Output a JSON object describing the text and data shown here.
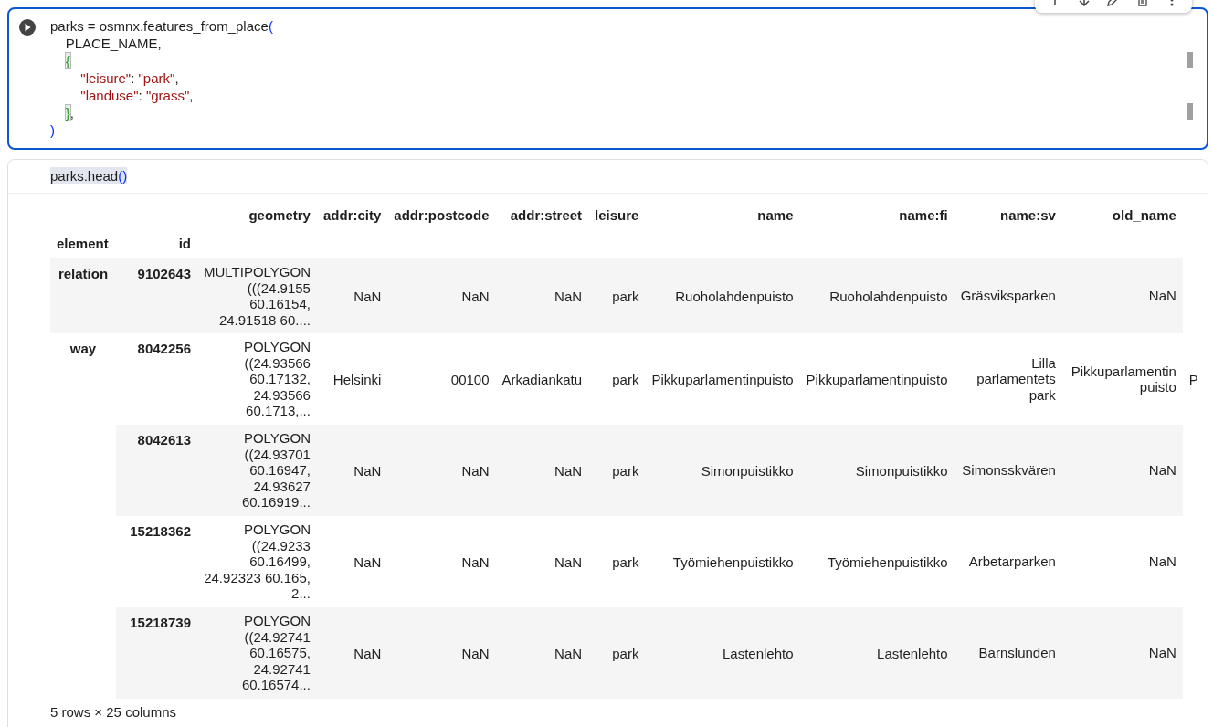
{
  "code_cell": {
    "selected": true,
    "lines": [
      [
        {
          "t": "parks = osmnx.features_from_place",
          "kind": "plain"
        },
        {
          "t": "(",
          "kind": "paren"
        }
      ],
      [
        {
          "t": "    PLACE_NAME,",
          "kind": "plain"
        }
      ],
      [
        {
          "t": "    {",
          "kind": "match"
        }
      ],
      [
        {
          "t": "        \"leisure\"",
          "kind": "string"
        },
        {
          "t": ": ",
          "kind": "plain"
        },
        {
          "t": "\"park\"",
          "kind": "string"
        },
        {
          "t": ",",
          "kind": "plain"
        }
      ],
      [
        {
          "t": "        \"landuse\"",
          "kind": "string"
        },
        {
          "t": ": ",
          "kind": "plain"
        },
        {
          "t": "\"grass\"",
          "kind": "string"
        },
        {
          "t": ",",
          "kind": "plain"
        }
      ],
      [
        {
          "t": "    }",
          "kind": "match"
        },
        {
          "t": ",",
          "kind": "plain"
        }
      ],
      [
        {
          "t": ")",
          "kind": "paren"
        }
      ]
    ]
  },
  "output_cell": {
    "selected": false,
    "code": [
      {
        "t": "parks.head",
        "kind": "plain"
      },
      {
        "t": "()",
        "kind": "paren"
      }
    ],
    "table": {
      "index_names": [
        "element",
        "id"
      ],
      "columns": [
        "geometry",
        "addr:city",
        "addr:postcode",
        "addr:street",
        "leisure",
        "name",
        "name:fi",
        "name:sv",
        "old_name"
      ],
      "rows": [
        {
          "element": "relation",
          "id": "9102643",
          "cells": [
            "MULTIPOLYGON (((24.9155 60.16154, 24.91518 60....",
            "NaN",
            "NaN",
            "NaN",
            "park",
            "Ruoholahdenpuisto",
            "Ruoholahdenpuisto",
            "Gräsviksparken",
            "NaN"
          ]
        },
        {
          "element": "way",
          "id": "8042256",
          "cells": [
            "POLYGON ((24.93566 60.17132, 24.93566 60.1713,...",
            "Helsinki",
            "00100",
            "Arkadiankatu",
            "park",
            "Pikkuparlamentinpuisto",
            "Pikkuparlamentinpuisto",
            "Lilla parlamentets park",
            "Pikkuparlamentin puisto",
            "P"
          ]
        },
        {
          "id": "8042613",
          "cells": [
            "POLYGON ((24.93701 60.16947, 24.93627 60.16919...",
            "NaN",
            "NaN",
            "NaN",
            "park",
            "Simonpuistikko",
            "Simonpuistikko",
            "Simonsskvären",
            "NaN"
          ]
        },
        {
          "id": "15218362",
          "cells": [
            "POLYGON ((24.9233 60.16499, 24.92323 60.165, 2...",
            "NaN",
            "NaN",
            "NaN",
            "park",
            "Työmiehenpuistikko",
            "Työmiehenpuistikko",
            "Arbetarparken",
            "NaN"
          ]
        },
        {
          "id": "15218739",
          "cells": [
            "POLYGON ((24.92741 60.16575, 24.92741 60.16574...",
            "NaN",
            "NaN",
            "NaN",
            "park",
            "Lastenlehto",
            "Lastenlehto",
            "Barnslunden",
            "NaN"
          ]
        }
      ],
      "caption": "5 rows × 25 columns"
    }
  }
}
